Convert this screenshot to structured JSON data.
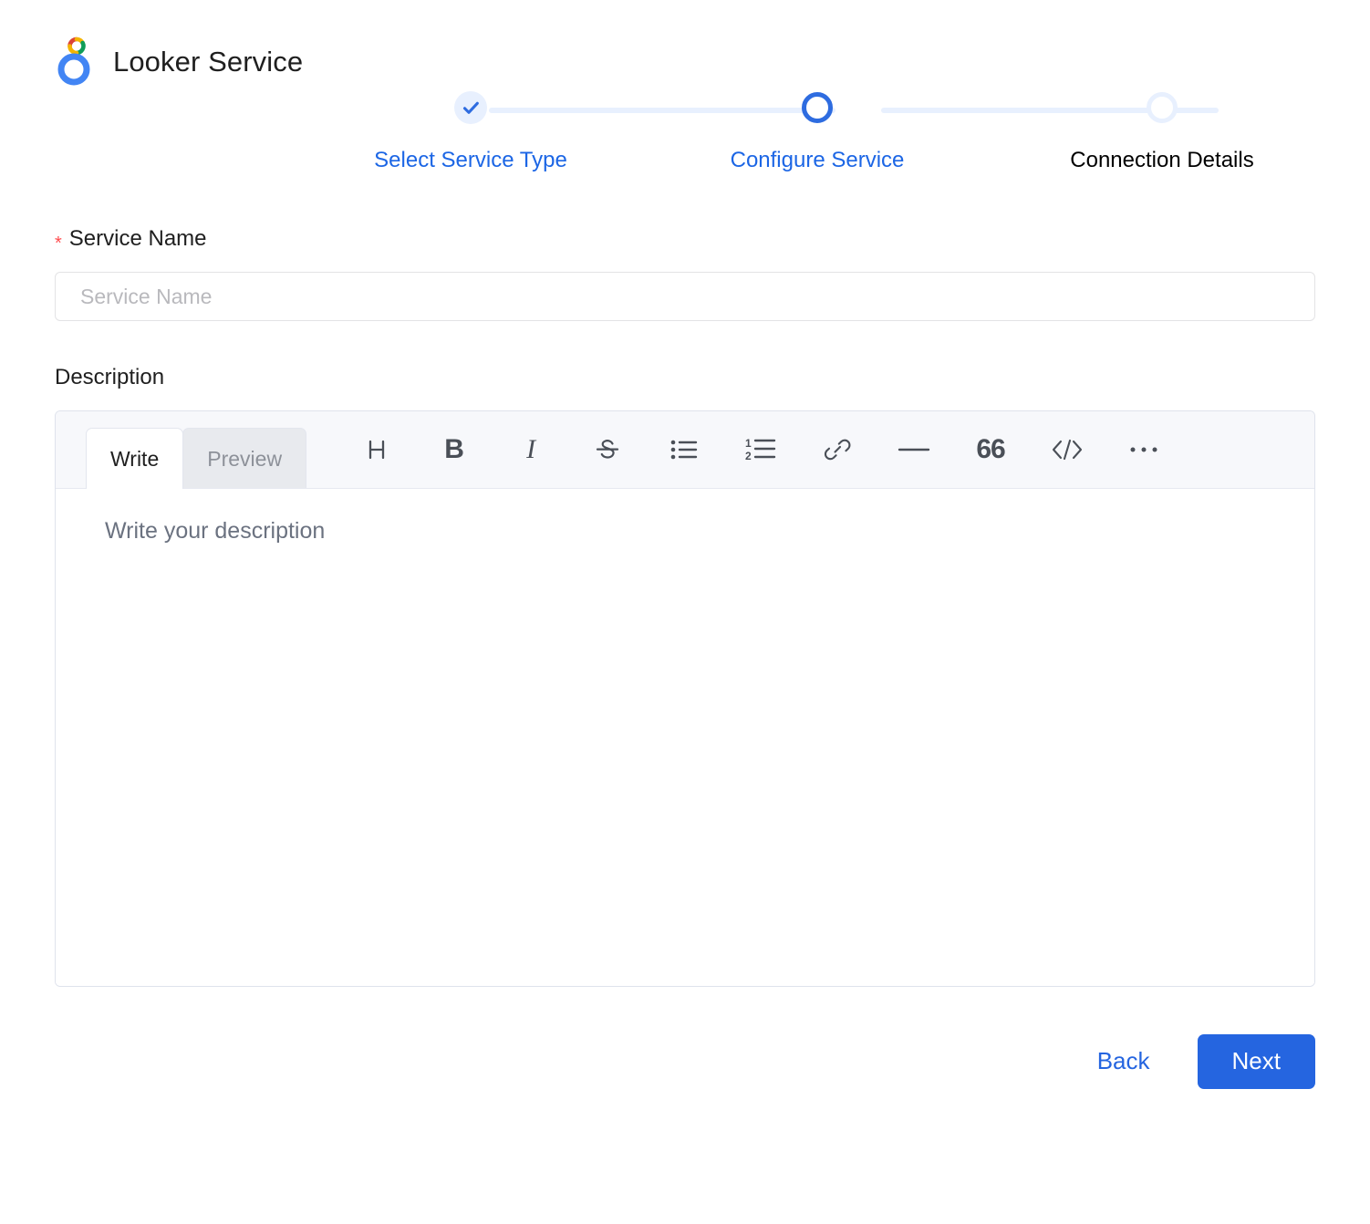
{
  "header": {
    "title": "Looker Service",
    "logo_icon": "looker-logo-icon",
    "logo_colors": {
      "blue": "#4285F4",
      "red": "#DB4437",
      "yellow": "#F4B400",
      "green": "#0F9D58"
    }
  },
  "stepper": {
    "accent_color": "#1c66e5",
    "line_color": "#e8f0fe",
    "steps": [
      {
        "label": "Select Service Type",
        "state": "done",
        "icon": "check-icon"
      },
      {
        "label": "Configure Service",
        "state": "active",
        "icon": "circle-icon"
      },
      {
        "label": "Connection Details",
        "state": "todo",
        "icon": "circle-icon"
      }
    ]
  },
  "form": {
    "service_name": {
      "label": "Service Name",
      "required_marker": "*",
      "required_color": "#ff4d4f",
      "value": "",
      "placeholder": "Service Name"
    },
    "description": {
      "label": "Description",
      "editor": {
        "tabs": [
          {
            "label": "Write",
            "active": true
          },
          {
            "label": "Preview",
            "active": false
          }
        ],
        "toolbar": [
          {
            "name": "heading-icon",
            "glyph": "H",
            "title": "Heading"
          },
          {
            "name": "bold-icon",
            "glyph": "B",
            "title": "Bold"
          },
          {
            "name": "italic-icon",
            "glyph": "I",
            "title": "Italic"
          },
          {
            "name": "strikethrough-icon",
            "glyph": "S",
            "title": "Strikethrough"
          },
          {
            "name": "bulleted-list-icon",
            "glyph": "",
            "title": "Bulleted list"
          },
          {
            "name": "numbered-list-icon",
            "glyph": "",
            "title": "Numbered list"
          },
          {
            "name": "link-icon",
            "glyph": "",
            "title": "Link"
          },
          {
            "name": "horizontal-rule-icon",
            "glyph": "",
            "title": "Horizontal rule"
          },
          {
            "name": "quote-icon",
            "glyph": "66",
            "title": "Quote"
          },
          {
            "name": "code-icon",
            "glyph": "</>",
            "title": "Code"
          },
          {
            "name": "more-options-icon",
            "glyph": "",
            "title": "More"
          }
        ],
        "placeholder": "Write your description"
      }
    }
  },
  "footer": {
    "back_label": "Back",
    "next_label": "Next",
    "primary_color": "#2565e0"
  }
}
